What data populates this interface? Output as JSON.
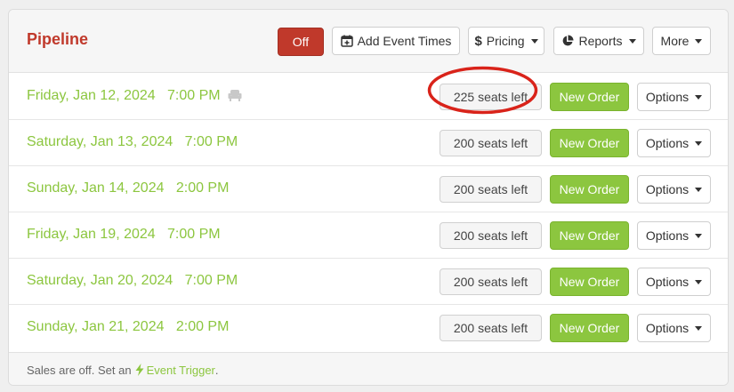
{
  "header": {
    "title": "Pipeline",
    "off_label": "Off",
    "add_event_times_label": "Add Event Times",
    "pricing_label": "Pricing",
    "reports_label": "Reports",
    "more_label": "More"
  },
  "events": [
    {
      "date": "Friday, Jan 12, 2024",
      "time": "7:00 PM",
      "seats": "225 seats left",
      "new_order": "New Order",
      "options": "Options"
    },
    {
      "date": "Saturday, Jan 13, 2024",
      "time": "7:00 PM",
      "seats": "200 seats left",
      "new_order": "New Order",
      "options": "Options"
    },
    {
      "date": "Sunday, Jan 14, 2024",
      "time": "2:00 PM",
      "seats": "200 seats left",
      "new_order": "New Order",
      "options": "Options"
    },
    {
      "date": "Friday, Jan 19, 2024",
      "time": "7:00 PM",
      "seats": "200 seats left",
      "new_order": "New Order",
      "options": "Options"
    },
    {
      "date": "Saturday, Jan 20, 2024",
      "time": "7:00 PM",
      "seats": "200 seats left",
      "new_order": "New Order",
      "options": "Options"
    },
    {
      "date": "Sunday, Jan 21, 2024",
      "time": "2:00 PM",
      "seats": "200 seats left",
      "new_order": "New Order",
      "options": "Options"
    }
  ],
  "footer": {
    "text": "Sales are off. Set an",
    "link": "Event Trigger",
    "end": "."
  },
  "colors": {
    "brand_red": "#c0392b",
    "green": "#8cc63f",
    "annotation_red": "#d9231a"
  },
  "icons": {
    "add_event_times": "calendar-plus-icon",
    "pricing": "dollar-icon",
    "reports": "pie-chart-icon",
    "seat": "seat-icon",
    "event_trigger": "lightning-icon"
  }
}
